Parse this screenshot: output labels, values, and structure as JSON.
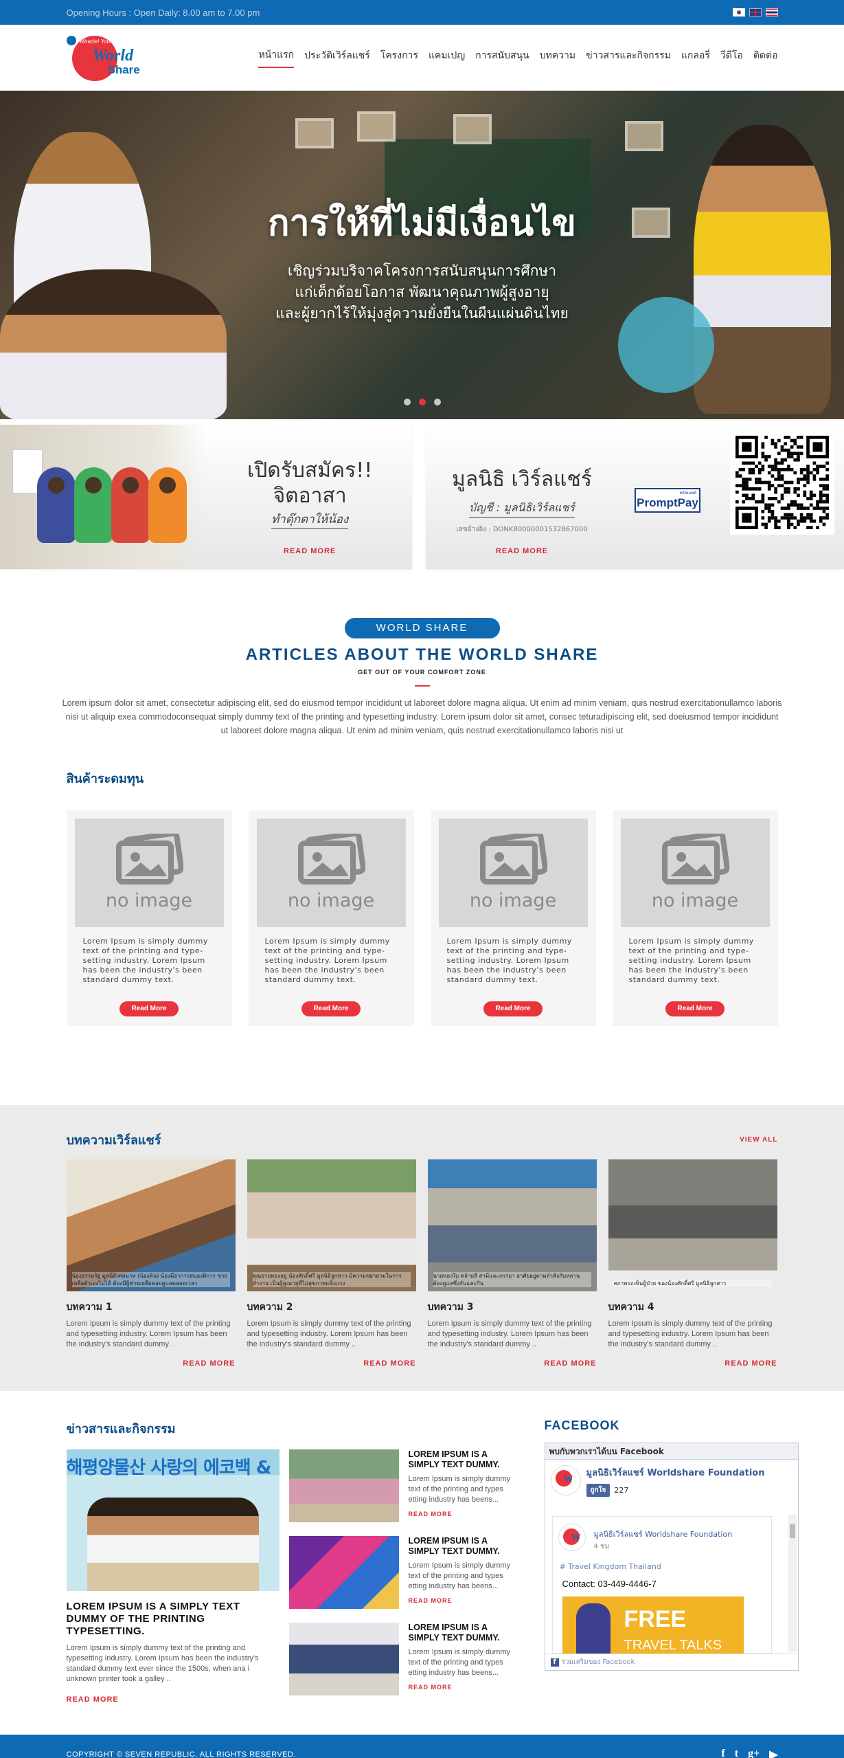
{
  "topbar": {
    "hours": "Opening Hours : Open Daily: 8.00 am to 7.00 pm",
    "flags": [
      "korea-flag",
      "uk-flag",
      "thai-flag"
    ]
  },
  "logo": {
    "tagline": "Miracle! You can make it",
    "word1": "World",
    "word2": "Share"
  },
  "nav": {
    "items": [
      "หน้าแรก",
      "ประวัติเวิร์ลแชร์",
      "โครงการ",
      "แคมเปญ",
      "การสนับสนุน",
      "บทความ",
      "ข่าวสารและกิจกรรม",
      "แกลอรี่",
      "วีดีโอ",
      "ติดต่อ"
    ],
    "active_index": 0
  },
  "hero": {
    "title": "การให้ที่ไม่มีเงื่อนไข",
    "line1": "เชิญร่วมบริจาคโครงการสนับสนุนการศึกษา",
    "line2": "แก่เด็กด้อยโอกาส พัฒนาคุณภาพผู้สูงอายุ",
    "line3": "และผู้ยากไร้ให้มุ่งสู่ความยั่งยืนในผืนแผ่นดินไทย",
    "slides": 3,
    "active_slide": 1
  },
  "promo_volunteer": {
    "line1": "เปิดรับสมัคร!!",
    "line2": "จิตอาสา",
    "line3": "ทำตุ๊กตาให้น้อง",
    "readmore": "READ MORE"
  },
  "promo_donate": {
    "name": "มูลนิธิ เวิร์ลแชร์",
    "account": "บัญชี : มูลนิธิเวิร์ลแชร์",
    "account_no": "เลขอ้างอิง : DONK80000001532867000",
    "readmore": "READ MORE",
    "promptpay_small": "พร้อมเพย์",
    "promptpay": "PromptPay"
  },
  "about": {
    "pill": "WORLD SHARE",
    "heading": "ARTICLES ABOUT THE WORLD SHARE",
    "subheading": "GET OUT OF YOUR COMFORT ZONE",
    "paragraph": "Lorem ipsum dolor sit amet, consectetur adipiscing elit, sed do eiusmod tempor incididunt ut laboreet dolore magna aliqua. Ut enim ad minim veniam, quis nostrud exercitationullamco laboris nisi ut aliquip exea commodoconsequat simply dummy text of the printing and typesetting industry. Lorem ipsum dolor sit amet, consec teturadipiscing elit, sed doeiusmod tempor incididunt ut laboreet dolore magna aliqua. Ut enim ad minim veniam, quis nostrud exercitationullamco laboris nisi ut"
  },
  "products": {
    "title": "สินค้าระดมทุน",
    "items": [
      {
        "image_text": "no image",
        "desc": "Lorem Ipsum is simply dummy text of the printing and type-setting industry. Lorem Ipsum has been the industry's been standard dummy text.",
        "button": "Read More"
      },
      {
        "image_text": "no image",
        "desc": "Lorem Ipsum is simply dummy text of the printing and type-setting industry. Lorem Ipsum has been the industry's been standard dummy text.",
        "button": "Read More"
      },
      {
        "image_text": "no image",
        "desc": "Lorem Ipsum is simply dummy text of the printing and type-setting industry. Lorem Ipsum has been the industry's been standard dummy text.",
        "button": "Read More"
      },
      {
        "image_text": "no image",
        "desc": "Lorem Ipsum is simply dummy text of the printing and type-setting industry. Lorem Ipsum has been the industry's been standard dummy text.",
        "button": "Read More"
      }
    ]
  },
  "wsarticles": {
    "title": "บทความเวิร์ลแชร์",
    "viewall": "VIEW ALL",
    "items": [
      {
        "title": "บทความ 1",
        "caption": "น้องธรรมรัฐ มูลนิธิเคทมาท (น้องต้น) น้องมีอาการสมองพิการ ช่วยเหลือตัวเองไม่ได้ ต้องมีผู้ช่วยเหลือคอยดูแลตลอดเวลา",
        "desc": "Lorem Ipsum is simply dummy text of the printing and typesetting industry. Lorem Ipsum has been the industry's standard dummy ..",
        "readmore": "READ MORE"
      },
      {
        "title": "บทความ 2",
        "caption": "คุณยายทองอยู่ น้องศักดิ์ศรี มูลนิธิลูกสาว มีความพยายามในการทำงาน เป็นผู้สูงอายุที่ไม่สุขภาพแข็งแรง",
        "desc": "Lorem Ipsum is simply dummy text of the printing and typesetting industry. Lorem Ipsum has been the industry's standard dummy ..",
        "readmore": "READ MORE"
      },
      {
        "title": "บทความ 3",
        "caption": "นายทองใบ คล้ายสี สามีและภรรยา อาศัยอยู่ตามลำพังกับหลาน ต้องดูแลซึ่งกันและกัน",
        "desc": "Lorem Ipsum is simply dummy text of the printing and typesetting industry. Lorem Ipsum has been the industry's standard dummy ..",
        "readmore": "READ MORE"
      },
      {
        "title": "บทความ 4",
        "caption": "สภาพรถเข็นผู้ป่วย ของน้องศักดิ์ศรี มูลนิธิลูกสาว",
        "desc": "Lorem Ipsum is simply dummy text of the printing and typesetting industry. Lorem Ipsum has been the industry's standard dummy ..",
        "readmore": "READ MORE"
      }
    ]
  },
  "news": {
    "title": "ข่าวสารและกิจกรรม",
    "main": {
      "banner": "해평양물산 사랑의 에코백 &",
      "title": "LOREM IPSUM IS A SIMPLY TEXT DUMMY OF THE PRINTING TYPESETTING.",
      "desc": "Lorem Ipsum is simply dummy text of the printing and typesetting industry. Lorem Ipsum has been the industry's standard dummy text ever since the 1500s, when ana i unknown printer took a galley ..",
      "readmore": "READ MORE"
    },
    "items": [
      {
        "title": "LOREM IPSUM IS A SIMPLY TEXT DUMMY.",
        "desc": "Lorem Ipsum is simply dummy text of the printing and types etting industry has beens...",
        "readmore": "READ MORE"
      },
      {
        "title": "LOREM IPSUM IS A SIMPLY TEXT DUMMY.",
        "desc": "Lorem Ipsum is simply dummy text of the printing and types etting industry has beens...",
        "readmore": "READ MORE"
      },
      {
        "title": "LOREM IPSUM IS A SIMPLY TEXT DUMMY.",
        "desc": "Lorem Ipsum is simply dummy text of the printing and types etting industry has beens...",
        "readmore": "READ MORE"
      }
    ]
  },
  "facebook": {
    "title": "FACEBOOK",
    "header": "พบกับพวกเราได้บน Facebook",
    "page_name": "มูลนิธิเวิร์ลแชร์ Worldshare Foundation",
    "like": "ถูกใจ",
    "likes": "227",
    "post_name": "มูลนิธิเวิร์ลแชร์ Worldshare Foundation",
    "post_time": "4 ชม",
    "post_tag": "# Travel Kingdom Thailand",
    "post_contact": "Contact: 03-449-4446-7",
    "ad_free": "FREE",
    "ad_sub": "TRAVEL TALKS",
    "footer": "ร่วมเสริมของ Facebook"
  },
  "footer": {
    "copyright": "COPYRIGHT © SEVEN REPUBLIC. ALL RIGHTS RESERVED.",
    "social": [
      "f",
      "t",
      "g+",
      "yt"
    ]
  },
  "colors": {
    "brand_blue": "#0e6ab3",
    "accent_red": "#e8343c",
    "heading_navy": "#0e4d86"
  }
}
